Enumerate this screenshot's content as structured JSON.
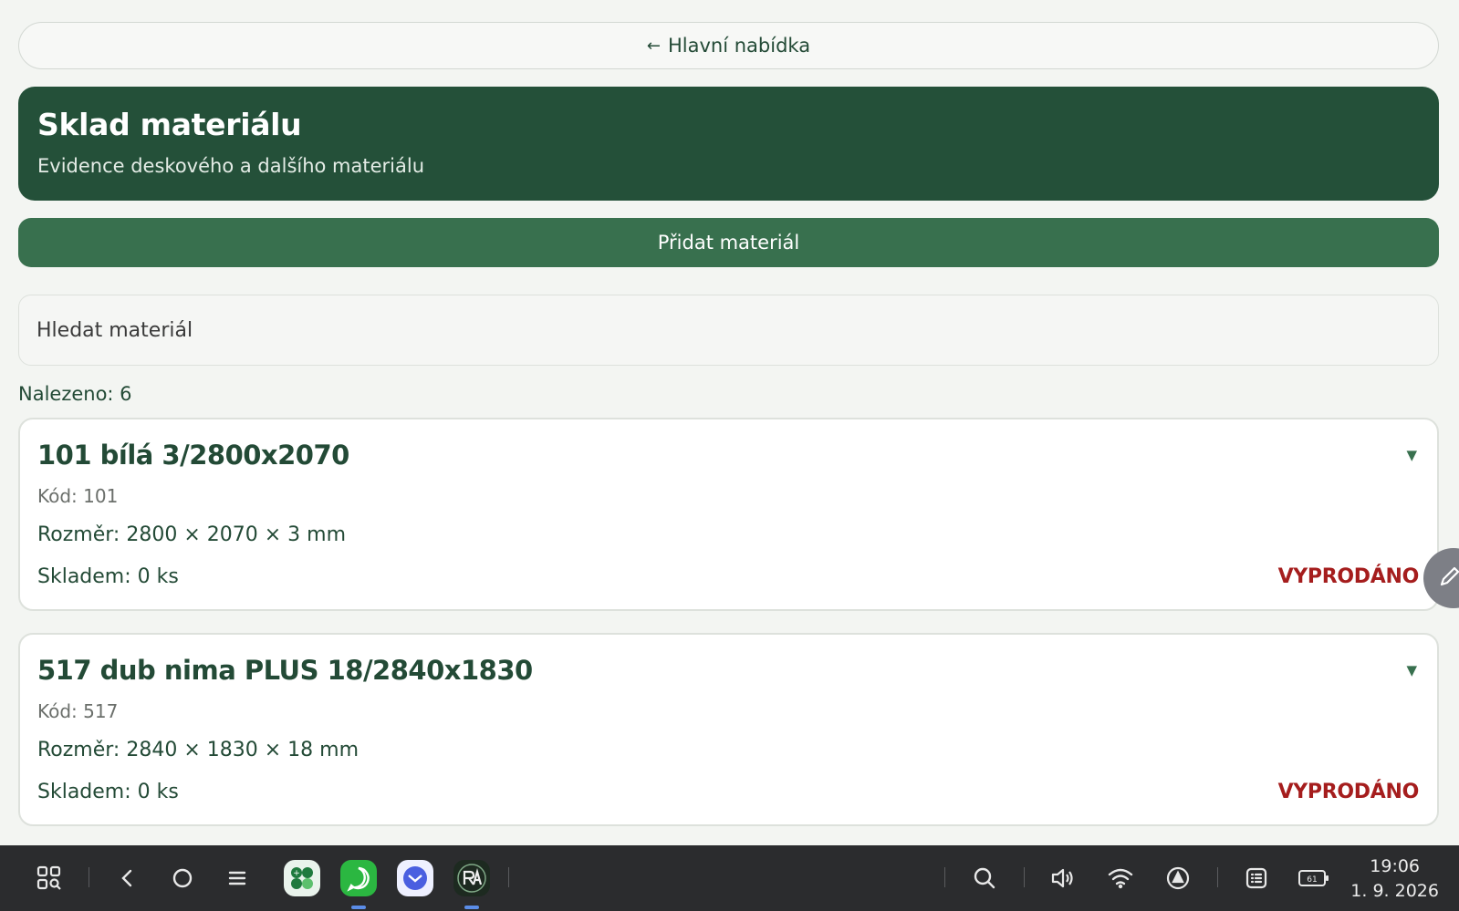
{
  "nav": {
    "back_arrow": "←",
    "back_label": "Hlavní nabídka"
  },
  "header": {
    "title": "Sklad materiálu",
    "subtitle": "Evidence deskového a dalšího materiálu"
  },
  "add_button": "Přidat materiál",
  "search": {
    "placeholder": "Hledat materiál",
    "value": ""
  },
  "found_label": "Nalezeno: 6",
  "materials": [
    {
      "name": "101 bílá 3/2800x2070",
      "code": "Kód: 101",
      "dimensions": "Rozměr: 2800 × 2070 × 3 mm",
      "stock": "Skladem: 0 ks",
      "status": "VYPRODÁNO"
    },
    {
      "name": "517 dub nima PLUS 18/2840x1830",
      "code": "Kód: 517",
      "dimensions": "Rozměr: 2840 × 1830 × 18 mm",
      "stock": "Skladem: 0 ks",
      "status": "VYPRODÁNO"
    }
  ],
  "chevron": "▼",
  "colors": {
    "primary_dark": "#245039",
    "primary": "#38704e",
    "sold_out": "#a51d1d",
    "background": "#f3f5f2",
    "taskbar": "#2b2c2e"
  },
  "taskbar": {
    "icons": [
      "apps-grid-icon",
      "back-icon",
      "home-icon",
      "menu-icon",
      "search-icon",
      "volume-icon",
      "wifi-icon",
      "navigation-icon",
      "notes-icon",
      "battery-icon"
    ],
    "apps": [
      "calculator-app-icon",
      "whatsapp-app-icon",
      "mail-app-icon",
      "ra-app-icon"
    ],
    "battery": "61",
    "time": "19:06",
    "date": "1. 9. 2026"
  }
}
